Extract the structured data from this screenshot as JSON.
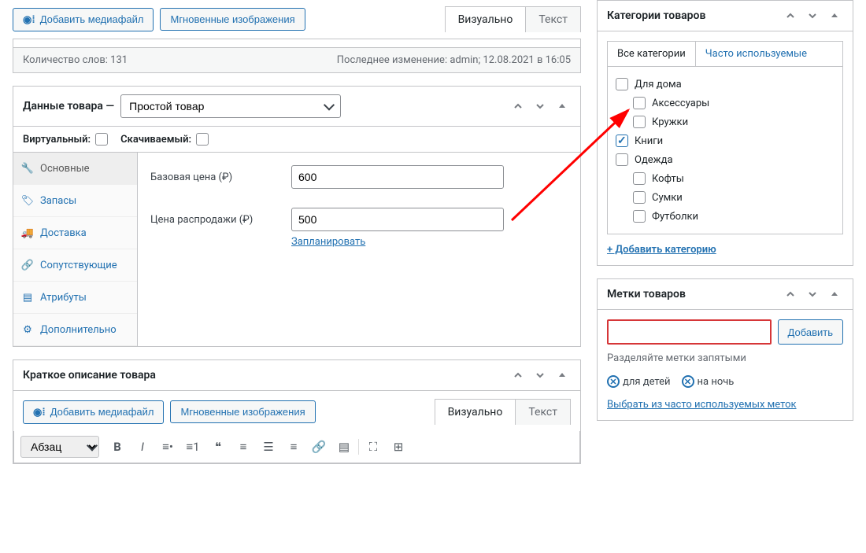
{
  "top": {
    "add_media": "Добавить медиафайл",
    "instant_images": "Мгновенные изображения",
    "tab_visual": "Визуально",
    "tab_text": "Текст"
  },
  "statusbar": {
    "word_count": "Количество слов: 131",
    "last_edit": "Последнее изменение: admin; 12.08.2021 в 16:05"
  },
  "product_data": {
    "title": "Данные товара —",
    "type_select": "Простой товар",
    "virtual_label": "Виртуальный:",
    "downloadable_label": "Скачиваемый:",
    "tabs": {
      "general": "Основные",
      "inventory": "Запасы",
      "shipping": "Доставка",
      "linked": "Сопутствующие",
      "attributes": "Атрибуты",
      "advanced": "Дополнительно"
    },
    "fields": {
      "regular_price_label": "Базовая цена (₽)",
      "regular_price_value": "600",
      "sale_price_label": "Цена распродажи (₽)",
      "sale_price_value": "500",
      "schedule_link": "Запланировать"
    }
  },
  "short_desc": {
    "title": "Краткое описание товара",
    "add_media": "Добавить медиафайл",
    "instant_images": "Мгновенные изображения",
    "tab_visual": "Визуально",
    "tab_text": "Текст",
    "para_select": "Абзац"
  },
  "categories": {
    "title": "Категории товаров",
    "tab_all": "Все категории",
    "tab_used": "Часто используемые",
    "items": [
      {
        "label": "Для дома",
        "checked": false,
        "children": [
          {
            "label": "Аксессуары",
            "checked": false
          },
          {
            "label": "Кружки",
            "checked": false
          }
        ]
      },
      {
        "label": "Книги",
        "checked": true
      },
      {
        "label": "Одежда",
        "checked": false,
        "children": [
          {
            "label": "Кофты",
            "checked": false
          },
          {
            "label": "Сумки",
            "checked": false
          },
          {
            "label": "Футболки",
            "checked": false
          }
        ]
      }
    ],
    "add_link": "+ Добавить категорию"
  },
  "tags": {
    "title": "Метки товаров",
    "add_btn": "Добавить",
    "hint": "Разделяйте метки запятыми",
    "chips": [
      "для детей",
      "на ночь"
    ],
    "choose_link": "Выбрать из часто используемых меток"
  }
}
